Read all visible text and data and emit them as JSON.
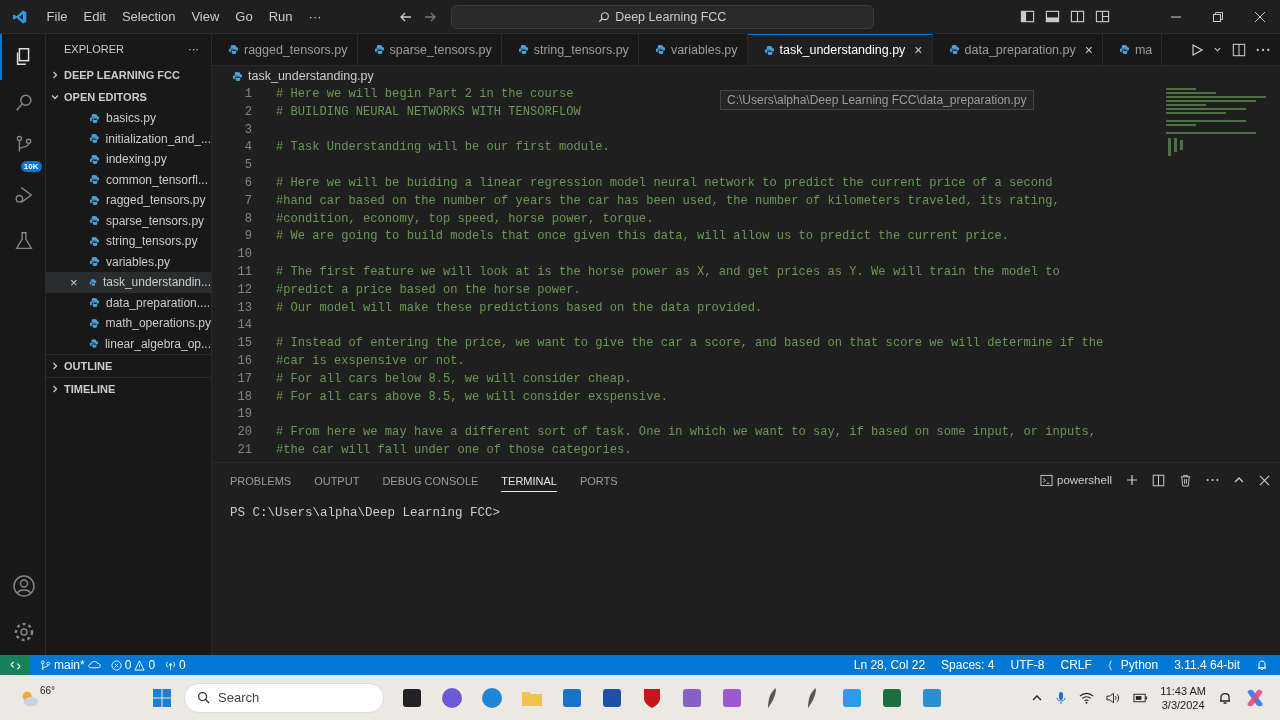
{
  "title_bar": {
    "menu": [
      "File",
      "Edit",
      "Selection",
      "View",
      "Go",
      "Run",
      "···"
    ],
    "search": "Deep Learning FCC"
  },
  "activity_bar": {
    "items": [
      {
        "kind": "files",
        "selected": true
      },
      {
        "kind": "search",
        "selected": false
      },
      {
        "kind": "source-control",
        "selected": false,
        "badge": "10K"
      },
      {
        "kind": "debug",
        "selected": false
      },
      {
        "kind": "flask",
        "selected": false
      }
    ]
  },
  "sidebar": {
    "title": "EXPLORER",
    "more": "···",
    "sections": [
      {
        "label": "DEEP LEARNING FCC",
        "expanded": false
      },
      {
        "label": "OPEN EDITORS",
        "expanded": true,
        "items": [
          {
            "label": "basics.py",
            "selected": false
          },
          {
            "label": "initialization_and_...",
            "selected": false
          },
          {
            "label": "indexing.py",
            "selected": false
          },
          {
            "label": "common_tensorfl...",
            "selected": false
          },
          {
            "label": "ragged_tensors.py",
            "selected": false
          },
          {
            "label": "sparse_tensors.py",
            "selected": false
          },
          {
            "label": "string_tensors.py",
            "selected": false
          },
          {
            "label": "variables.py",
            "selected": false
          },
          {
            "label": "task_understandin...",
            "selected": true,
            "close": "×"
          },
          {
            "label": "data_preparation....",
            "selected": false
          },
          {
            "label": "math_operations.py",
            "selected": false
          },
          {
            "label": "linear_algebra_op...",
            "selected": false
          }
        ]
      },
      {
        "label": "OUTLINE",
        "expanded": false
      },
      {
        "label": "TIMELINE",
        "expanded": false
      }
    ]
  },
  "tabs": [
    {
      "label": "ragged_tensors.py",
      "selected": false
    },
    {
      "label": "sparse_tensors.py",
      "selected": false
    },
    {
      "label": "string_tensors.py",
      "selected": false
    },
    {
      "label": "variables.py",
      "selected": false
    },
    {
      "label": "task_understanding.py",
      "selected": true,
      "close": "×"
    },
    {
      "label": "data_preparation.py",
      "selected": false,
      "close": "×"
    },
    {
      "label": "ma",
      "selected": false
    }
  ],
  "breadcrumb": "task_understanding.py",
  "tooltip": "C:\\Users\\alpha\\Deep Learning FCC\\data_preparation.py",
  "code": [
    {
      "n": "1",
      "text": "# Here we will begin Part 2 in the course"
    },
    {
      "n": "2",
      "text": "# BUILDING NEURAL NETWORKS WITH TENSORFLOW"
    },
    {
      "n": "3"
    },
    {
      "n": "4",
      "text": "# Task Understanding will be our first module."
    },
    {
      "n": "5"
    },
    {
      "n": "6",
      "text": "# Here we will be buiding a linear regression model neural network to predict the current price of a second"
    },
    {
      "n": "7",
      "text": "#hand car based on the number of years the car has been used, the number of kilometers traveled, its rating,"
    },
    {
      "n": "8",
      "text": "#condition, economy, top speed, horse power, torque."
    },
    {
      "n": "9",
      "text": "# We are going to build models that once given this data, will allow us to predict the current price."
    },
    {
      "n": "10"
    },
    {
      "n": "11",
      "text": "# The first feature we will look at is the horse power as X, and get prices as Y. We will train the model to"
    },
    {
      "n": "12",
      "text": "#predict a price based on the horse power."
    },
    {
      "n": "13",
      "text": "# Our model will make these predictions based on the data provided."
    },
    {
      "n": "14"
    },
    {
      "n": "15",
      "text": "# Instead of entering the price, we want to give the car a score, and based on that score we will determine if the"
    },
    {
      "n": "16",
      "text": "#car is exspensive or not."
    },
    {
      "n": "17",
      "text": "# For all cars below 8.5, we will consider cheap."
    },
    {
      "n": "18",
      "text": "# For all cars above 8.5, we will consider exspensive."
    },
    {
      "n": "19"
    },
    {
      "n": "20",
      "text": "# From here we may have a different sort of task. One in which we want to say, if based on some input, or inputs,"
    },
    {
      "n": "21",
      "text": "#the car will fall under one of those categories."
    }
  ],
  "panel": {
    "tabs": [
      {
        "label": "PROBLEMS",
        "selected": false
      },
      {
        "label": "OUTPUT",
        "selected": false
      },
      {
        "label": "DEBUG CONSOLE",
        "selected": false
      },
      {
        "label": "TERMINAL",
        "selected": true
      },
      {
        "label": "PORTS",
        "selected": false
      }
    ],
    "shell": "powershell",
    "prompt": "PS C:\\Users\\alpha\\Deep Learning FCC>"
  },
  "status_bar": {
    "branch": "main*",
    "errors": "0",
    "warnings": "0",
    "ports": "0",
    "right": [
      "Ln 28, Col 22",
      "Spaces: 4",
      "UTF-8",
      "CRLF",
      "Python",
      "3.11.4 64-bit"
    ]
  },
  "taskbar": {
    "weather": "66°",
    "search_placeholder": "Search",
    "time": "11:43 AM",
    "date": "3/3/2024"
  }
}
